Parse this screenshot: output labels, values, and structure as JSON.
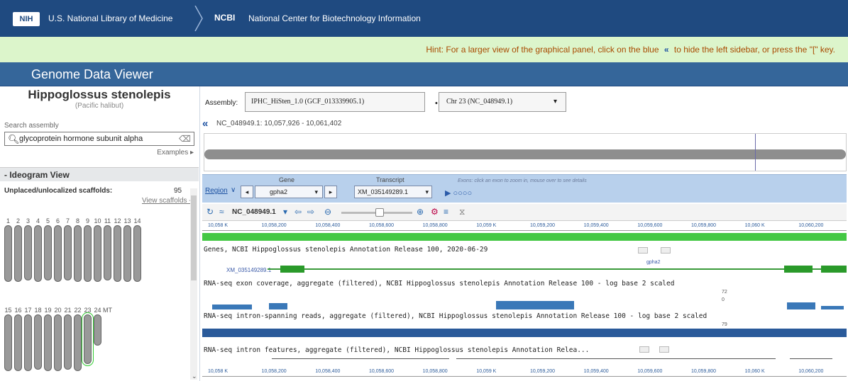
{
  "header": {
    "nih_logo": "NIH",
    "nlm_title": "U.S. National Library of Medicine",
    "ncbi_abbr": "NCBI",
    "ncbi_full": "National Center for Biotechnology Information"
  },
  "hint": {
    "before": "Hint: For a larger view of the graphical panel, click on the blue",
    "chevron": "«",
    "after": "to hide the left sidebar, or press the \"[\" key."
  },
  "app_title": "Genome Data Viewer",
  "sidebar": {
    "organism": "Hippoglossus stenolepis",
    "common_name": "(Pacific halibut)",
    "search_label": "Search assembly",
    "search_value": "glycoprotein hormone subunit alpha",
    "examples_link": "Examples ▸",
    "ideogram_heading": "- Ideogram View",
    "unplaced_label": "Unplaced/unlocalized scaffolds:",
    "unplaced_count": "95",
    "view_scaffolds_link": "View scaffolds --",
    "chromosomes_row1": [
      {
        "label": "1",
        "h": 80
      },
      {
        "label": "2",
        "h": 80
      },
      {
        "label": "3",
        "h": 78
      },
      {
        "label": "4",
        "h": 80
      },
      {
        "label": "5",
        "h": 78
      },
      {
        "label": "6",
        "h": 80
      },
      {
        "label": "7",
        "h": 78
      },
      {
        "label": "8",
        "h": 80
      },
      {
        "label": "9",
        "h": 80
      },
      {
        "label": "10",
        "h": 80
      },
      {
        "label": "11",
        "h": 78
      },
      {
        "label": "12",
        "h": 80
      },
      {
        "label": "13",
        "h": 80
      },
      {
        "label": "14",
        "h": 80
      }
    ],
    "chromosomes_row2": [
      {
        "label": "15",
        "h": 80
      },
      {
        "label": "16",
        "h": 80
      },
      {
        "label": "17",
        "h": 80
      },
      {
        "label": "18",
        "h": 78
      },
      {
        "label": "19",
        "h": 80
      },
      {
        "label": "20",
        "h": 80
      },
      {
        "label": "21",
        "h": 78
      },
      {
        "label": "22",
        "h": 80
      },
      {
        "label": "23",
        "h": 70,
        "selected": true
      },
      {
        "label": "24",
        "h": 44
      },
      {
        "label": "MT",
        "h": 0
      }
    ]
  },
  "assembly": {
    "label": "Assembly:",
    "selected": "IPHC_HiSten_1.0 (GCF_013339905.1)",
    "chromosome": "Chr 23 (NC_048949.1)"
  },
  "viewer": {
    "collapse_icon": "«",
    "coordinates": "NC_048949.1: 10,057,926 - 10,061,402",
    "region_label": "Region",
    "gene_label": "Gene",
    "gene_value": "gpha2",
    "transcript_label": "Transcript",
    "transcript_value": "XM_035149289.1",
    "exons_hint": "Exons: click an exon to zoom in, mouse over to see details",
    "exon_dots": "▶ ○○○○",
    "toolbar_accession": "NC_048949.1",
    "ruler_ticks": [
      "10,058 K",
      "10,058,200",
      "10,058,400",
      "10,058,600",
      "10,058,800",
      "10,059 K",
      "10,059,200",
      "10,059,400",
      "10,059,600",
      "10,059,800",
      "10,060 K",
      "10,060,200"
    ],
    "tracks": {
      "genes": "Genes, NCBI Hippoglossus stenolepis Annotation Release 100, 2020-06-29",
      "gene_accession": "XM_035149289.1",
      "gene_name": "gpha2",
      "rnaseq_exon": "RNA-seq exon coverage, aggregate (filtered), NCBI Hippoglossus stenolepis Annotation Release 100 - log base 2 scaled",
      "exon_scale_hi": "72",
      "exon_scale_lo": "0",
      "rnaseq_intron_spanning": "RNA-seq intron-spanning reads, aggregate (filtered), NCBI Hippoglossus stenolepis Annotation Release 100 - log base 2 scaled",
      "intron_scale": "79",
      "rnaseq_intron_features": "RNA-seq intron features, aggregate (filtered), NCBI Hippoglossus stenolepis Annotation Relea..."
    }
  },
  "colors": {
    "header_bg": "#1f4a80",
    "hint_bg": "#dcf5cb",
    "title_bg": "#35669a",
    "gene_green": "#2a9a2a",
    "coverage_blue": "#3a78b8"
  }
}
